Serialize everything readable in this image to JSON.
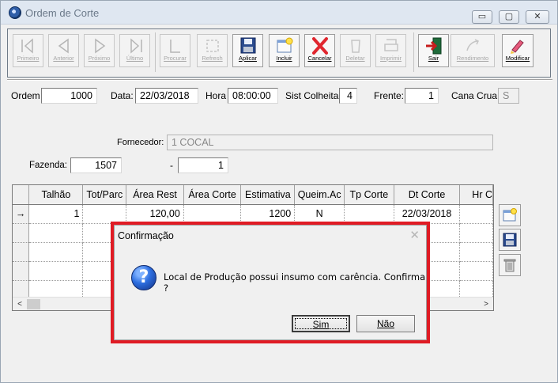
{
  "window": {
    "title": "Ordem de Corte",
    "minimize": "▭",
    "maximize": "▢",
    "close": "✕"
  },
  "toolbar": {
    "primeiro": "Primeiro",
    "anterior": "Anterior",
    "proximo": "Próximo",
    "ultimo": "Último",
    "procurar": "Procurar",
    "refresh": "Refresh",
    "aplicar": "Aplicar",
    "incluir": "Incluir",
    "cancelar": "Cancelar",
    "deletar": "Deletar",
    "imprimir": "Imprimir",
    "sair": "Sair",
    "rendimento": "Rendimento",
    "modificar": "Modificar"
  },
  "form": {
    "ordem_label": "Ordem",
    "ordem_value": "1000",
    "data_label": "Data:",
    "data_value": "22/03/2018",
    "hora_label": "Hora",
    "hora_value": "08:00:00",
    "sist_label": "Sist Colheita:",
    "sist_value": "4",
    "frente_label": "Frente:",
    "frente_value": "1",
    "cana_label": "Cana Crua:",
    "cana_value": "S",
    "fornecedor_label": "Fornecedor:",
    "fornecedor_value": "1 COCAL",
    "fazenda_label": "Fazenda:",
    "fazenda_value": "1507",
    "dash": "-",
    "fazenda_sub_value": "1"
  },
  "grid": {
    "columns": [
      "Talhão",
      "Tot/Parc",
      "Área Rest",
      "Área Corte",
      "Estimativa",
      "Queim.Ac",
      "Tp Corte",
      "Dt Corte",
      "Hr C"
    ],
    "row_indicator": "→",
    "rows": [
      [
        "1",
        "",
        "120,00",
        "",
        "1200",
        "N",
        "",
        "22/03/2018",
        ""
      ]
    ],
    "scroll_left": "<",
    "scroll_right": ">"
  },
  "dialog": {
    "title": "Confirmação",
    "close": "✕",
    "icon": "?",
    "message": "Local de Produção possui insumo com carência. Confirma ?",
    "yes": "Sim",
    "no": "Não"
  },
  "colors": {
    "highlight": "#e01b24",
    "question_icon": "#2d6ee0",
    "cancel_icon": "#e0262e",
    "exit_icon": "#c61c1c"
  }
}
